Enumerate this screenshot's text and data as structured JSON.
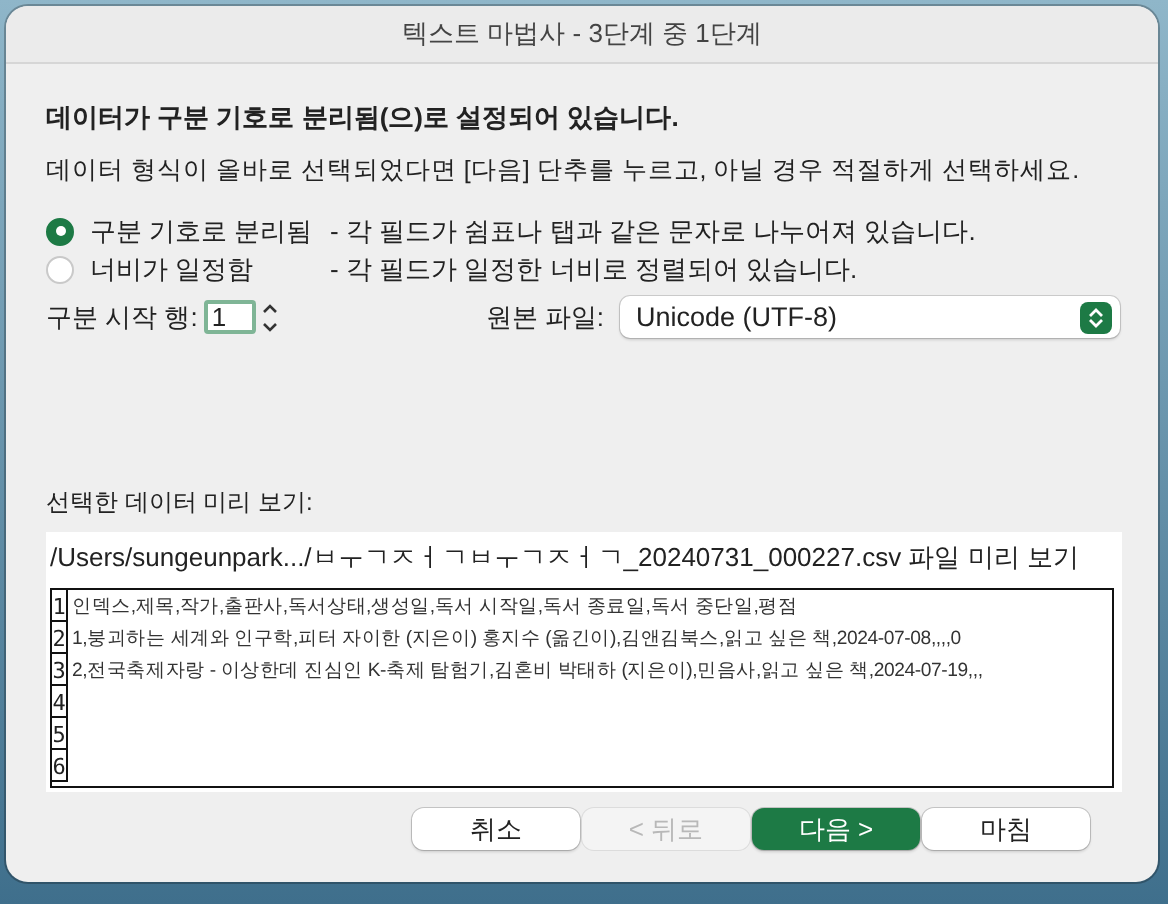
{
  "window": {
    "title": "텍스트 마법사 - 3단계 중 1단계"
  },
  "heading": "데이터가 구분 기호로 분리됨(으)로 설정되어 있습니다.",
  "instructions": "데이터 형식이 올바로 선택되었다면 [다음] 단추를 누르고, 아닐 경우 적절하게 선택하세요.",
  "data_type_options": [
    {
      "label": "구분 기호로 분리됨",
      "description": "- 각 필드가 쉼표나 탭과 같은 문자로 나누어져 있습니다.",
      "selected": true
    },
    {
      "label": "너비가 일정함",
      "description": "- 각 필드가 일정한 너비로 정렬되어 있습니다.",
      "selected": false
    }
  ],
  "start_row": {
    "label": "구분 시작 행:",
    "value": "1"
  },
  "file_origin": {
    "label": "원본 파일:",
    "value": "Unicode (UTF-8)"
  },
  "preview": {
    "label": "선택한 데이터 미리 보기:",
    "path": "/Users/sungeunpark.../ㅂㅜㄱㅈㅓㄱㅂㅜㄱㅈㅓㄱ_20240731_000227.csv 파일 미리 보기",
    "rows": [
      {
        "number": "1",
        "text": "인덱스,제목,작가,출판사,독서상태,생성일,독서 시작일,독서 종료일,독서 중단일,평점"
      },
      {
        "number": "2",
        "text": "1,붕괴하는 세계와 인구학,피터 자이한 (지은이)  홍지수 (옮긴이),김앤김북스,읽고 싶은 책,2024-07-08,,,,0"
      },
      {
        "number": "3",
        "text": "2,전국축제자랑 - 이상한데 진심인 K-축제 탐험기,김혼비  박태하 (지은이),민음사,읽고 싶은 책,2024-07-19,,,"
      },
      {
        "number": "4"
      },
      {
        "number": "5"
      },
      {
        "number": "6"
      }
    ]
  },
  "buttons": [
    {
      "label": "취소",
      "primary": false,
      "disabled": false
    },
    {
      "label": "< 뒤로",
      "primary": false,
      "disabled": true
    },
    {
      "label": "다음 >",
      "primary": true,
      "disabled": false
    },
    {
      "label": "마침",
      "primary": false,
      "disabled": false
    }
  ]
}
